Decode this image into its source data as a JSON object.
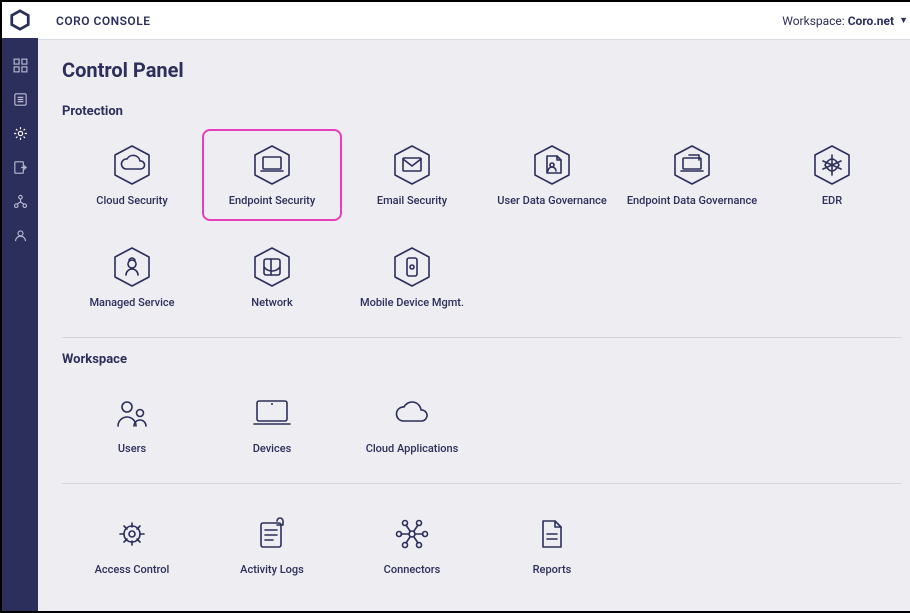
{
  "topbar": {
    "brand": "CORO CONSOLE",
    "workspace_label": "Workspace:",
    "workspace_name": "Coro.net"
  },
  "page": {
    "title": "Control Panel"
  },
  "sections": {
    "protection": {
      "title": "Protection",
      "items": [
        {
          "label": "Cloud Security"
        },
        {
          "label": "Endpoint Security"
        },
        {
          "label": "Email Security"
        },
        {
          "label": "User Data Governance"
        },
        {
          "label": "Endpoint Data Governance"
        },
        {
          "label": "EDR"
        },
        {
          "label": "Managed Service"
        },
        {
          "label": "Network"
        },
        {
          "label": "Mobile Device Mgmt."
        }
      ],
      "highlighted_index": 1
    },
    "workspace": {
      "title": "Workspace",
      "items": [
        {
          "label": "Users"
        },
        {
          "label": "Devices"
        },
        {
          "label": "Cloud Applications"
        }
      ]
    },
    "admin": {
      "items": [
        {
          "label": "Access Control"
        },
        {
          "label": "Activity Logs"
        },
        {
          "label": "Connectors"
        },
        {
          "label": "Reports"
        }
      ]
    }
  },
  "sidebar": {
    "items": [
      {
        "name": "dashboard"
      },
      {
        "name": "logs"
      },
      {
        "name": "control-panel",
        "active": true
      },
      {
        "name": "export"
      },
      {
        "name": "orgs"
      },
      {
        "name": "account"
      }
    ]
  },
  "colors": {
    "primary": "#2c2e5b",
    "highlight": "#e83fb8",
    "bg": "#ededf2"
  }
}
